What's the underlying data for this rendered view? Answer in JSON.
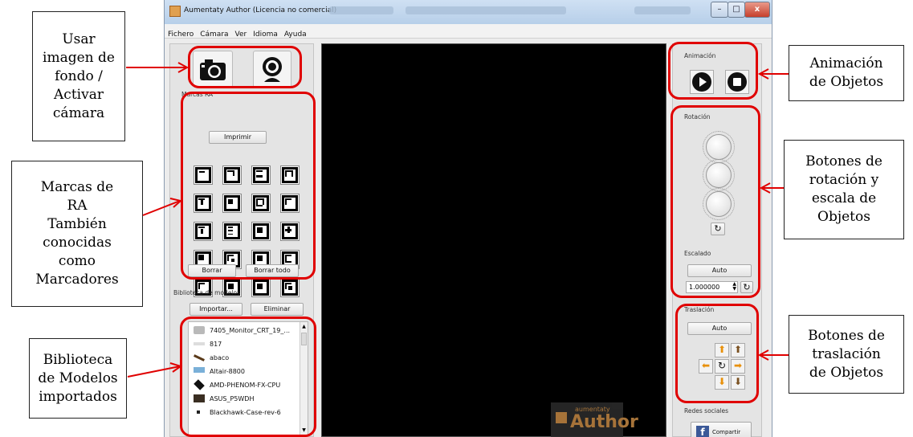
{
  "window": {
    "title": "Aumentaty Author (Licencia no comercial)",
    "buttons": {
      "minimize": "–",
      "maximize": "□",
      "close": "x"
    }
  },
  "menu": [
    "Fichero",
    "Cámara",
    "Ver",
    "Idioma",
    "Ayuda"
  ],
  "left": {
    "markers_group": "Marcas RA",
    "print_button": "Imprimir",
    "delete_button": "Borrar",
    "delete_all_button": "Borrar todo",
    "library_group": "Biblioteca de modelos",
    "import_button": "Importar...",
    "remove_button": "Eliminar",
    "models": [
      "7405_Monitor_CRT_19_...",
      "817",
      "abaco",
      "Altair-8800",
      "AMD-PHENOM-FX-CPU",
      "ASUS_P5WDH",
      "Blackhawk-Case-rev-6"
    ]
  },
  "right": {
    "animation_group": "Animación",
    "rotation_group": "Rotación",
    "scale_group": "Escalado",
    "scale_auto": "Auto",
    "scale_value": "1.000000",
    "translation_group": "Traslación",
    "translation_auto": "Auto",
    "social_group": "Redes sociales",
    "share_button": "Compartir"
  },
  "watermark": {
    "small": "aumentaty",
    "big": "Author"
  },
  "callouts": {
    "camera": [
      "Usar",
      "imagen de",
      "fondo /",
      "Activar",
      "cámara"
    ],
    "markers": [
      "Marcas de",
      "RA",
      "También",
      "conocidas",
      "como",
      "Marcadores"
    ],
    "library": [
      "Biblioteca",
      "de Modelos",
      "importados"
    ],
    "animation": [
      "Animación",
      "de Objetos"
    ],
    "rotation": [
      "Botones de",
      "rotación y",
      "escala de",
      "Objetos"
    ],
    "translation": [
      "Botones de",
      "traslación",
      "de Objetos"
    ]
  },
  "colors": {
    "highlight": "#e00000",
    "viewport": "#000000",
    "panel": "#e4e4e4"
  }
}
